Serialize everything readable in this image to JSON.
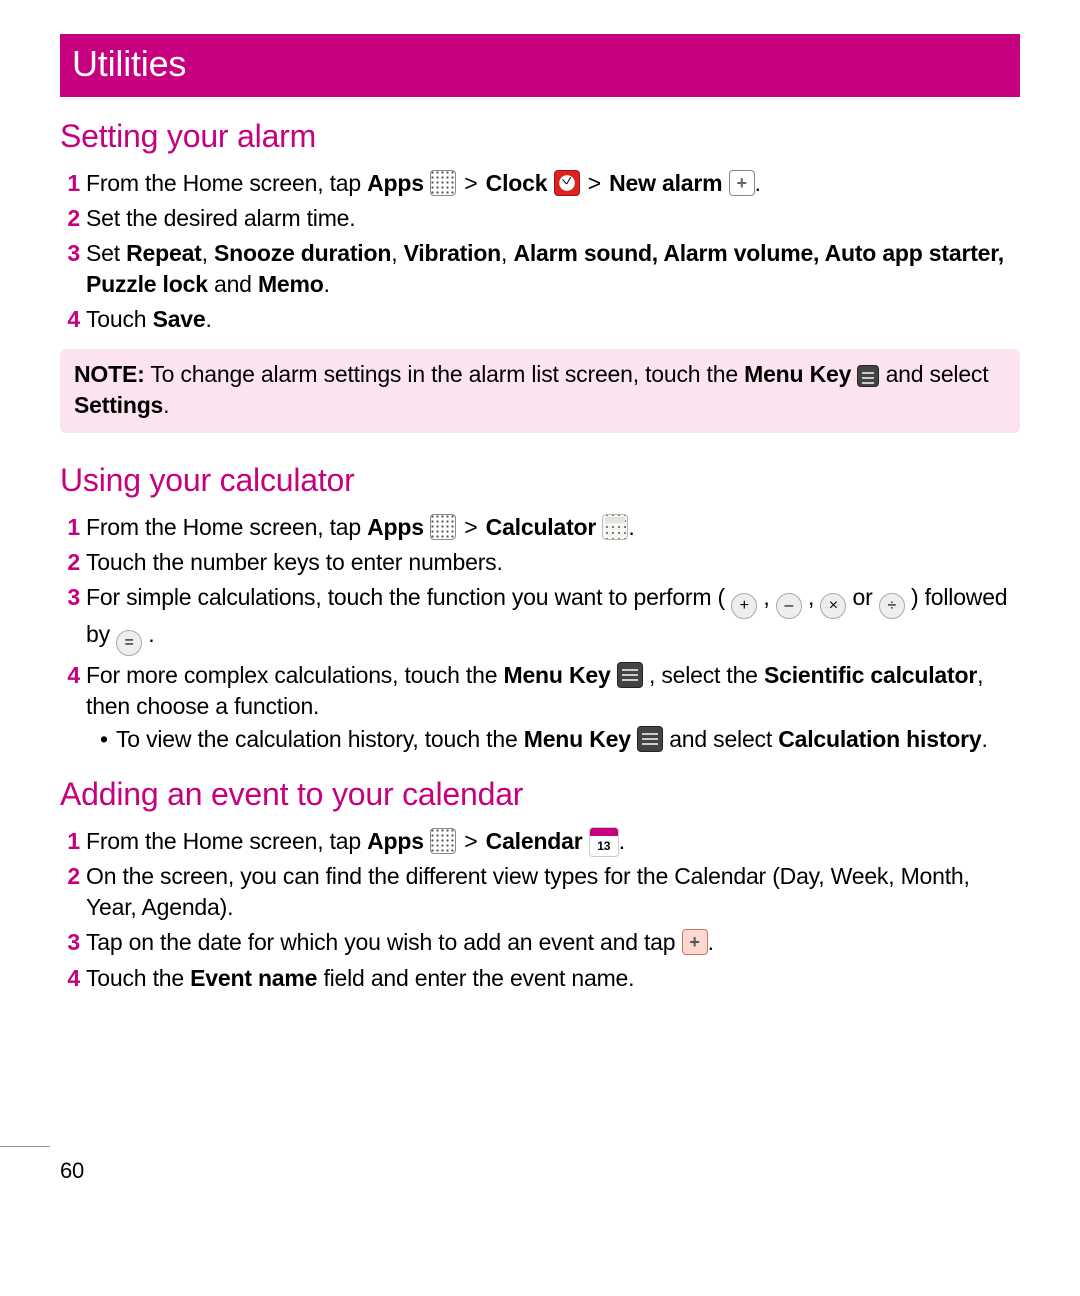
{
  "page_number": "60",
  "title": "Utilities",
  "alarm": {
    "heading": "Setting your alarm",
    "s1a": "From the Home screen, tap ",
    "s1_apps": "Apps",
    "s1_gt1": " > ",
    "s1_clock": "Clock",
    "s1_gt2": " > ",
    "s1_new": "New alarm",
    "s1_end": ".",
    "s2": "Set the desired alarm time.",
    "s3a": "Set ",
    "s3_r": "Repeat",
    "s3_c1": ", ",
    "s3_sd": "Snooze duration",
    "s3_c2": ", ",
    "s3_v": "Vibration",
    "s3_c3": ", ",
    "s3_as": "Alarm sound, Alarm volume, Auto app starter, Puzzle lock",
    "s3_and": " and ",
    "s3_m": "Memo",
    "s3_end": ".",
    "s4a": "Touch ",
    "s4_save": "Save",
    "s4_end": ".",
    "note_lead": "NOTE:",
    "note_a": " To change alarm settings in the alarm list screen, touch the ",
    "note_mk": "Menu Key",
    "note_b": " and select ",
    "note_set": "Settings",
    "note_end": "."
  },
  "calc": {
    "heading": "Using your calculator",
    "s1a": "From the Home screen, tap ",
    "s1_apps": "Apps",
    "s1_gt": " > ",
    "s1_calc": "Calculator",
    "s1_end": ".",
    "s2": "Touch the number keys to enter numbers.",
    "s3a": "For simple calculations, touch the function you want to perform ( ",
    "op_plus": "+",
    "c1": " , ",
    "op_min": "–",
    "c2": " , ",
    "op_mul": "×",
    "s3b": " or ",
    "op_div": "÷",
    "s3c": " ) followed by ",
    "op_eq": "=",
    "s3d": " .",
    "s4a": "For more complex calculations, touch the ",
    "s4_mk": "Menu Key",
    "s4b": " , select the ",
    "s4_sc": "Scientific calculator",
    "s4c": ", then choose a function.",
    "bul_a": "To view the calculation history, touch the ",
    "bul_mk": "Menu Key",
    "bul_b": " and select ",
    "bul_ch": "Calculation history",
    "bul_end": "."
  },
  "cal": {
    "heading": "Adding an event to your calendar",
    "day": "13",
    "s1a": "From the Home screen, tap ",
    "s1_apps": "Apps",
    "s1_gt": " > ",
    "s1_cal": "Calendar",
    "s1_end": ".",
    "s2": "On the screen, you can find the different view types for the Calendar (Day, Week, Month, Year, Agenda).",
    "s3a": "Tap on the date for which you wish to add an event and tap ",
    "s3_end": ".",
    "s4a": "Touch the ",
    "s4_en": "Event name",
    "s4b": " field and enter the event name."
  }
}
